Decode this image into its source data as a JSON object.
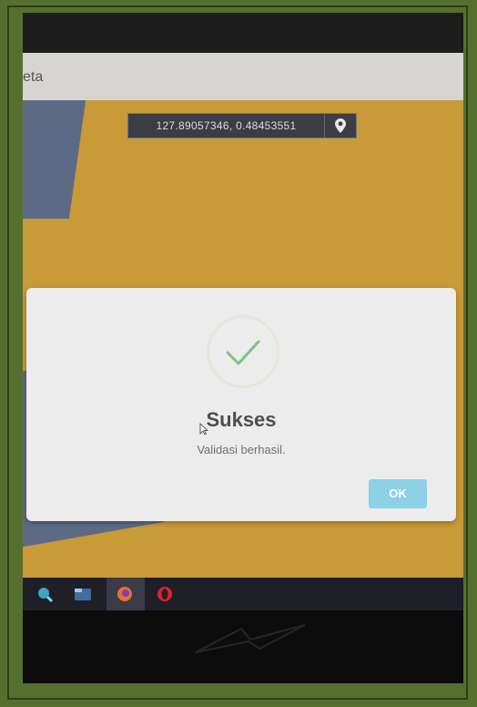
{
  "window": {
    "title_fragment": ""
  },
  "nav": {
    "title": "eta"
  },
  "map": {
    "coordinates": "127.89057346, 0.48453551",
    "location_icon": "map-pin-icon"
  },
  "dialog": {
    "icon": "check-icon",
    "title": "Sukses",
    "message": "Validasi berhasil.",
    "ok_label": "OK"
  },
  "taskbar": {
    "icons": [
      "search-icon",
      "folder-icon",
      "firefox-icon",
      "opera-icon"
    ]
  },
  "colors": {
    "map_bg": "#c99a38",
    "ok_button": "#8cd1e5",
    "check": "#7fc47a"
  }
}
